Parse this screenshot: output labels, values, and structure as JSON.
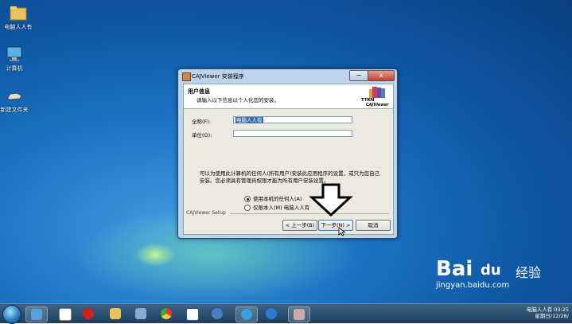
{
  "desktop": {
    "icons": [
      {
        "label": "电脑人人有",
        "kind": "folder"
      },
      {
        "label": "计算机",
        "kind": "computer"
      },
      {
        "label": "新建文件夹",
        "kind": "app"
      }
    ]
  },
  "window": {
    "title": "CAJViewer 安装程序",
    "header_title": "用户信息",
    "header_subtitle": "请输入以下信息以个人化您的安装。",
    "logo_text": "TTKN",
    "logo_sub": "CAJViewer",
    "fullname_label": "全称(F):",
    "fullname_value": "电脑人人有",
    "org_label": "单位(O):",
    "org_value": "",
    "paragraph": "可以为使用此计算机的任何人(所有用户)安装此应用程序的设置，或只为您自己安装。您必须具有管理员权限才能为所有用户安装设置。",
    "radio_all": "使用本机的任何人(A)",
    "radio_me": "仅限本人(M)  电脑人人有",
    "section_label": "CAJViewer Setup",
    "back_button": "< 上一步(B)",
    "next_button": "下一步(N) >",
    "cancel_button": "取消",
    "minimize": "−",
    "close": "x"
  },
  "taskbar": {
    "clock_line1": "电脑人人有 03:25",
    "clock_line2": "星期日/12/28/"
  },
  "watermark": {
    "main": "Bai",
    "paw": "du",
    "right": "经验",
    "sub": "jingyan.baidu.com"
  },
  "colors": {
    "desktop": "#1f78c8",
    "accent": "#3a6ea5"
  }
}
